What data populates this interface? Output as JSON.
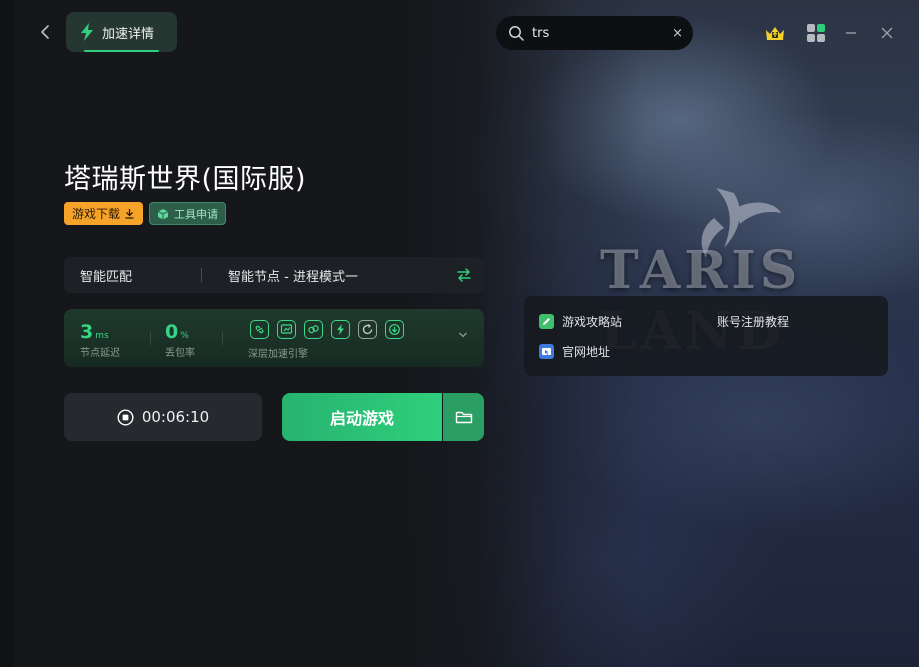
{
  "header": {
    "tab_label": "加速详情",
    "search_value": "trs",
    "clear_glyph": "×"
  },
  "game": {
    "title": "塔瑞斯世界(国际服)",
    "download_badge": "游戏下载",
    "tool_badge": "工具申请",
    "art_logo_text": "TARIS LAND"
  },
  "mode": {
    "match": "智能匹配",
    "node": "智能节点 - 进程模式一"
  },
  "stats": {
    "latency_value": "3",
    "latency_unit": "ms",
    "latency_label": "节点延迟",
    "loss_value": "0",
    "loss_unit": "%",
    "loss_label": "丢包率",
    "engine_label": "深层加速引擎"
  },
  "actions": {
    "timer": "00:06:10",
    "launch": "启动游戏"
  },
  "links": {
    "guide": "游戏攻略站",
    "register": "账号注册教程",
    "official": "官网地址"
  },
  "colors": {
    "accent_green": "#2fcf7c",
    "badge_orange": "#f6a32a",
    "crown_yellow": "#f2d12e"
  }
}
